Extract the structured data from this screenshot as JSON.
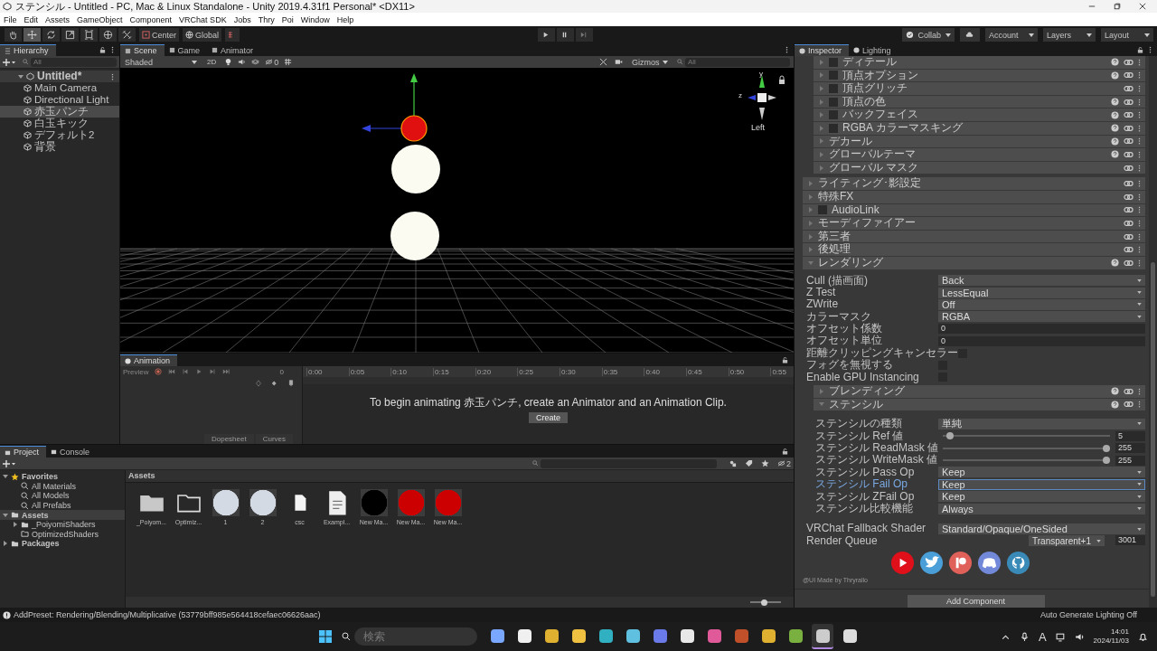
{
  "window": {
    "title": "ステンシル - Untitled - PC, Mac & Linux Standalone - Unity 2019.4.31f1 Personal* <DX11>"
  },
  "menu": [
    "File",
    "Edit",
    "Assets",
    "GameObject",
    "Component",
    "VRChat SDK",
    "Jobs",
    "Thry",
    "Poi",
    "Window",
    "Help"
  ],
  "toolbar": {
    "tools": [
      {
        "kind": "hand",
        "selected": false
      },
      {
        "kind": "move",
        "selected": true
      },
      {
        "kind": "rotate",
        "selected": false
      },
      {
        "kind": "scale",
        "selected": false
      },
      {
        "kind": "rect",
        "selected": false
      },
      {
        "kind": "transform",
        "selected": false
      },
      {
        "kind": "custom",
        "selected": false
      }
    ],
    "pivot": "Center",
    "space": "Global",
    "collab": "Collab",
    "account": "Account",
    "layers": "Layers",
    "layout": "Layout"
  },
  "hierarchy": {
    "tab": "Hierarchy",
    "search_placeholder": "All",
    "root": {
      "label": "Untitled*",
      "expanded": true,
      "children": [
        {
          "label": "Main Camera",
          "selected": false
        },
        {
          "label": "Directional Light",
          "selected": false
        },
        {
          "label": "赤玉パンチ",
          "selected": true
        },
        {
          "label": "白玉キック",
          "selected": false
        },
        {
          "label": "デフォルト2",
          "selected": false
        },
        {
          "label": "背景",
          "selected": false
        }
      ]
    }
  },
  "scene": {
    "tabs": [
      {
        "label": "Scene",
        "selected": true
      },
      {
        "label": "Game",
        "selected": false
      },
      {
        "label": "Animator",
        "selected": false
      }
    ],
    "shading": "Shaded",
    "mode_2d": "2D",
    "hidden_count": "0",
    "gizmos": "Gizmos",
    "search_placeholder": "All",
    "axis_y": "y",
    "axis_z": "z",
    "view_label": "Left"
  },
  "animation": {
    "tab": "Animation",
    "preview": "Preview",
    "frame": "0",
    "time_labels": [
      "0:00",
      "0:05",
      "0:10",
      "0:15",
      "0:20",
      "0:25",
      "0:30",
      "0:35",
      "0:40",
      "0:45",
      "0:50",
      "0:55"
    ],
    "message": "To begin animating 赤玉パンチ, create an Animator and an Animation Clip.",
    "create": "Create",
    "dopesheet": "Dopesheet",
    "curves": "Curves"
  },
  "project": {
    "tabs": [
      {
        "label": "Project",
        "selected": true
      },
      {
        "label": "Console",
        "selected": false
      }
    ],
    "hidden_count": "2",
    "tree": [
      {
        "label": "Favorites",
        "kind": "star",
        "expanded": true,
        "selected": false,
        "children": [
          {
            "label": "All Materials",
            "kind": "search"
          },
          {
            "label": "All Models",
            "kind": "search"
          },
          {
            "label": "All Prefabs",
            "kind": "search"
          }
        ]
      },
      {
        "label": "Assets",
        "kind": "folder",
        "expanded": true,
        "selected": true,
        "children": [
          {
            "label": "_PoiyomiShaders",
            "kind": "folder"
          },
          {
            "label": "OptimizedShaders",
            "kind": "folder-empty"
          }
        ]
      },
      {
        "label": "Packages",
        "kind": "folder",
        "expanded": false,
        "selected": false
      }
    ],
    "icon_size": {
      "level": 0.45
    },
    "path": "Assets",
    "assets": [
      {
        "label": "_Poiyom...",
        "kind": "folder"
      },
      {
        "label": "Optimiz...",
        "kind": "folder-empty"
      },
      {
        "label": "1",
        "kind": "material",
        "color": "#d3dae4"
      },
      {
        "label": "2",
        "kind": "material",
        "color": "#d3dae4"
      },
      {
        "label": "csc",
        "kind": "file"
      },
      {
        "label": "Exampl...",
        "kind": "document"
      },
      {
        "label": "New Ma...",
        "kind": "material",
        "color": "#000000"
      },
      {
        "label": "New Ma...",
        "kind": "material",
        "color": "#cc0000"
      },
      {
        "label": "New Ma...",
        "kind": "material",
        "color": "#cc0000"
      }
    ]
  },
  "inspector": {
    "tabs": [
      {
        "label": "Inspector",
        "selected": true
      },
      {
        "label": "Lighting",
        "selected": false
      }
    ],
    "sub_sections": [
      {
        "label": "ディテール",
        "kind": "toggle",
        "checked": false,
        "help": true
      },
      {
        "label": "頂点オプション",
        "kind": "toggle",
        "checked": false,
        "help": true
      },
      {
        "label": "頂点グリッチ",
        "kind": "toggle",
        "checked": false,
        "help": false
      },
      {
        "label": "頂点の色",
        "kind": "toggle",
        "checked": false,
        "help": true
      },
      {
        "label": "バックフェイス",
        "kind": "toggle",
        "checked": false,
        "help": true
      },
      {
        "label": "RGBA カラーマスキング",
        "kind": "toggle",
        "checked": false,
        "help": true
      },
      {
        "label": "デカール",
        "kind": "plain",
        "help": true
      },
      {
        "label": "グローバルテーマ",
        "kind": "plain",
        "help": true
      },
      {
        "label": "グローバル マスク",
        "kind": "plain",
        "help": false
      }
    ],
    "sections": [
      {
        "label": "ライティング･影設定",
        "kind": "plain",
        "help": false,
        "expanded": false
      },
      {
        "label": "特殊FX",
        "kind": "plain",
        "help": false,
        "expanded": false
      },
      {
        "label": "AudioLink",
        "kind": "toggle",
        "checked": false,
        "help": false,
        "expanded": false
      },
      {
        "label": "モーディファイアー",
        "kind": "plain",
        "help": false,
        "expanded": false
      },
      {
        "label": "第三者",
        "kind": "plain",
        "help": false,
        "expanded": false
      },
      {
        "label": "後処理",
        "kind": "plain",
        "help": false,
        "expanded": false
      },
      {
        "label": "レンダリング",
        "kind": "plain",
        "help": true,
        "expanded": true
      }
    ],
    "rendering": [
      {
        "label": "Cull (描画面)",
        "kind": "dropdown",
        "value": "Back"
      },
      {
        "label": "Z Test",
        "kind": "dropdown",
        "value": "LessEqual"
      },
      {
        "label": "ZWrite",
        "kind": "dropdown",
        "value": "Off"
      },
      {
        "label": "カラーマスク",
        "kind": "dropdown",
        "value": "RGBA"
      },
      {
        "label": "オフセット係数",
        "kind": "number",
        "value": "0"
      },
      {
        "label": "オフセット単位",
        "kind": "number",
        "value": "0"
      },
      {
        "label": "距離クリッピングキャンセラー",
        "kind": "checkbox",
        "checked": false
      },
      {
        "label": "フォグを無視する",
        "kind": "checkbox",
        "checked": false
      },
      {
        "label": "Enable GPU Instancing",
        "kind": "checkbox",
        "checked": false
      }
    ],
    "blending": {
      "label": "ブレンディング",
      "help": true,
      "expanded": false
    },
    "stencil": {
      "label": "ステンシル",
      "help": true,
      "expanded": true,
      "properties": [
        {
          "label": "ステンシルの種類",
          "kind": "dropdown",
          "value": "単純",
          "focused": false
        },
        {
          "label": "ステンシル Ref 値",
          "kind": "slider",
          "level": 0.02,
          "value": "5",
          "focused": false
        },
        {
          "label": "ステンシル ReadMask 値",
          "kind": "slider",
          "level": 1,
          "value": "255",
          "focused": false
        },
        {
          "label": "ステンシル WriteMask 値",
          "kind": "slider",
          "level": 1,
          "value": "255",
          "focused": false
        },
        {
          "label": "ステンシル Pass Op",
          "kind": "dropdown",
          "value": "Keep",
          "focused": false
        },
        {
          "label": "ステンシル Fail Op",
          "kind": "dropdown",
          "value": "Keep",
          "focused": true
        },
        {
          "label": "ステンシル ZFail Op",
          "kind": "dropdown",
          "value": "Keep",
          "focused": false
        },
        {
          "label": "ステンシル比較機能",
          "kind": "dropdown",
          "value": "Always",
          "focused": false
        }
      ]
    },
    "fallback": {
      "label": "VRChat Fallback Shader",
      "value": "Standard/Opaque/OneSided"
    },
    "render_queue": {
      "label": "Render Queue",
      "preset": "Transparent+1",
      "value": "3001"
    },
    "links": [
      {
        "kind": "youtube",
        "color": "#e0101a"
      },
      {
        "kind": "twitter",
        "color": "#4a9fd8"
      },
      {
        "kind": "patreon",
        "color": "#e0605a"
      },
      {
        "kind": "discord",
        "color": "#7289da"
      },
      {
        "kind": "github",
        "color": "#3a8ab8"
      }
    ],
    "credit": "@UI Made by Thryrallo",
    "add_component": "Add Component"
  },
  "status_bar": {
    "message": "AddPreset: Rendering/Blending/Multiplicative (53779bff985e564418cefaec06626aac)",
    "right": "Auto Generate Lighting Off"
  },
  "taskbar": {
    "search_placeholder": "検索",
    "apps": [
      {
        "kind": "copilot",
        "active": false
      },
      {
        "kind": "character",
        "active": false
      },
      {
        "kind": "chrome",
        "active": false
      },
      {
        "kind": "explorer",
        "active": false
      },
      {
        "kind": "captions",
        "active": false
      },
      {
        "kind": "notepad",
        "active": false
      },
      {
        "kind": "discord",
        "active": false
      },
      {
        "kind": "cube",
        "active": false
      },
      {
        "kind": "music",
        "active": false
      },
      {
        "kind": "crab",
        "active": false
      },
      {
        "kind": "chrome",
        "active": false
      },
      {
        "kind": "v",
        "active": false
      },
      {
        "kind": "unity",
        "active": true
      },
      {
        "kind": "obs",
        "active": false
      }
    ],
    "ime": "A",
    "time": "14:01",
    "date": "2024/11/03"
  }
}
